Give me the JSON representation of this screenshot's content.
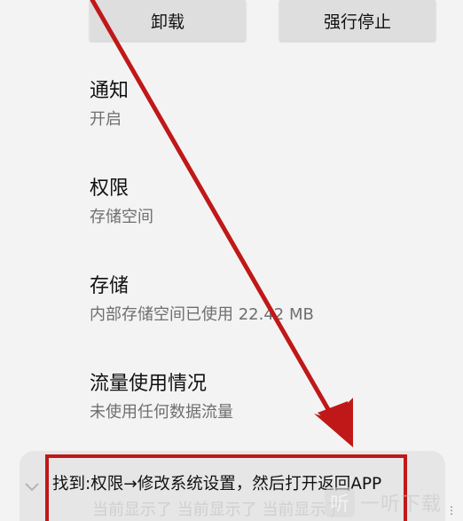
{
  "buttons": {
    "uninstall": "卸载",
    "force_stop": "强行停止"
  },
  "items": [
    {
      "title": "通知",
      "subtitle": "开启"
    },
    {
      "title": "权限",
      "subtitle": "存储空间"
    },
    {
      "title": "存储",
      "subtitle": "内部存储空间已使用 22.42 MB"
    },
    {
      "title": "流量使用情况",
      "subtitle": "未使用任何数据流量"
    }
  ],
  "annotation": {
    "text": "找到:权限→修改系统设置，然后打开返回APP",
    "color": "#c01818"
  },
  "ticker": {
    "text": "当前显示了 当前显示了 当前显示了"
  },
  "watermark": {
    "logo": "听",
    "text": "一听下载"
  },
  "colors": {
    "background": "#f3f3f3",
    "button": "#dedede",
    "arrow": "#c01818"
  }
}
